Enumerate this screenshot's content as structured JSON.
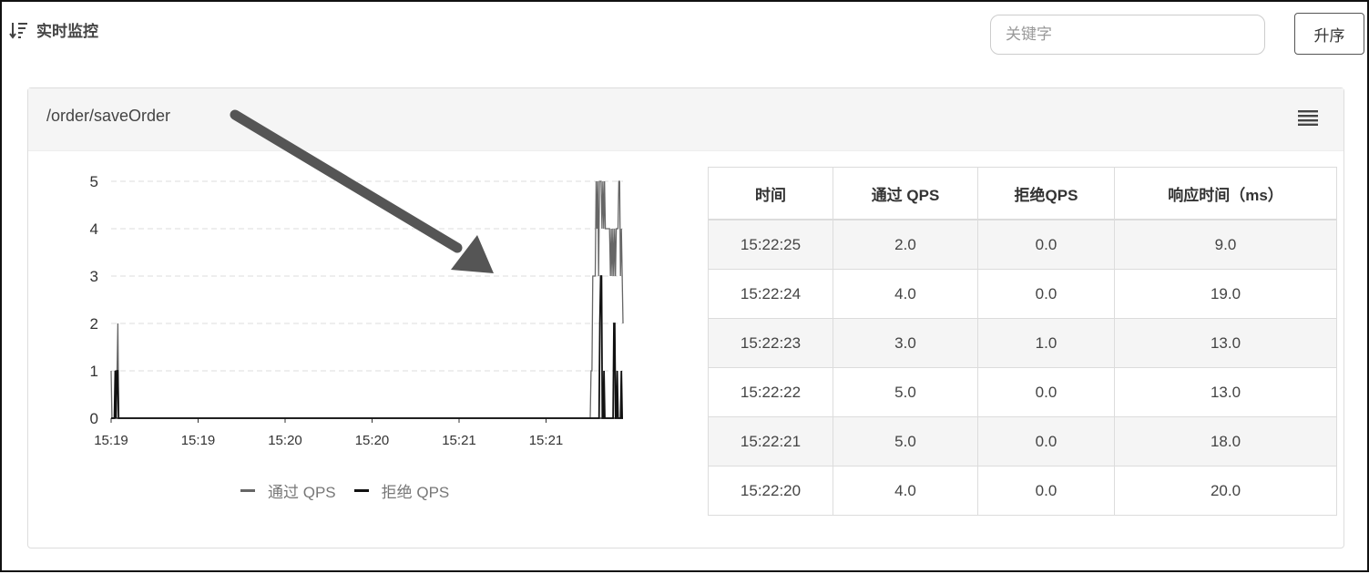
{
  "header": {
    "title": "实时监控",
    "search_placeholder": "关键字",
    "search_value": "",
    "sort_label": "升序"
  },
  "panel": {
    "resource": "/order/saveOrder",
    "menu_icon": "hamburger-menu-icon"
  },
  "chart_data": {
    "type": "line",
    "ylim": [
      0,
      5
    ],
    "yticks": [
      0,
      1,
      2,
      3,
      4,
      5
    ],
    "xtick_labels": [
      "15:19",
      "15:19",
      "15:20",
      "15:20",
      "15:21",
      "15:21"
    ],
    "grid": true,
    "legend_position": "bottom",
    "series": [
      {
        "name": "通过 QPS",
        "color": "#666666",
        "values": [
          1,
          0,
          0,
          0,
          0,
          1,
          1,
          1,
          2,
          0,
          0,
          0,
          0,
          0,
          0,
          0,
          0,
          0,
          0,
          0,
          0,
          0,
          0,
          0,
          0,
          0,
          0,
          0,
          0,
          0,
          0,
          0,
          0,
          0,
          0,
          0,
          0,
          0,
          0,
          0,
          0,
          0,
          0,
          0,
          0,
          0,
          0,
          0,
          0,
          0,
          0,
          0,
          0,
          0,
          0,
          0,
          0,
          0,
          0,
          0,
          0,
          0,
          0,
          0,
          0,
          0,
          0,
          0,
          0,
          0,
          0,
          0,
          0,
          0,
          0,
          0,
          0,
          0,
          0,
          0,
          0,
          0,
          0,
          0,
          0,
          0,
          0,
          0,
          0,
          0,
          0,
          0,
          0,
          0,
          0,
          0,
          0,
          0,
          0,
          0,
          0,
          0,
          0,
          0,
          0,
          0,
          0,
          0,
          0,
          0,
          0,
          0,
          0,
          0,
          0,
          0,
          0,
          0,
          0,
          0,
          0,
          0,
          0,
          0,
          0,
          0,
          0,
          0,
          0,
          0,
          0,
          0,
          0,
          0,
          0,
          0,
          0,
          0,
          0,
          0,
          0,
          0,
          0,
          0,
          0,
          0,
          0,
          0,
          0,
          0,
          0,
          0,
          0,
          0,
          0,
          0,
          0,
          0,
          0,
          0,
          0,
          0,
          0,
          0,
          0,
          0,
          0,
          0,
          0,
          0,
          0,
          0,
          0,
          0,
          0,
          0,
          0,
          0,
          0,
          0,
          0,
          0,
          0,
          0,
          0,
          0,
          0,
          0,
          0,
          0,
          0,
          0,
          0,
          0,
          0,
          0,
          0,
          0,
          0,
          0,
          0,
          0,
          0,
          0,
          0,
          0,
          0,
          0,
          0,
          0,
          0,
          0,
          0,
          0,
          0,
          0,
          0,
          0,
          0,
          0,
          0,
          0,
          0,
          0,
          0,
          0,
          0,
          0,
          0,
          0,
          0,
          0,
          0,
          0,
          0,
          0,
          0,
          0,
          0,
          0,
          0,
          0,
          0,
          0,
          0,
          0,
          0,
          0,
          0,
          0,
          0,
          0,
          0,
          0,
          0,
          0,
          0,
          0,
          0,
          0,
          0,
          0,
          0,
          0,
          0,
          0,
          0,
          0,
          0,
          0,
          0,
          0,
          0,
          0,
          0,
          0,
          0,
          0,
          0,
          0,
          0,
          0,
          0,
          0,
          0,
          0,
          0,
          0,
          0,
          0,
          0,
          0,
          0,
          0,
          0,
          0,
          0,
          0,
          0,
          0,
          0,
          0,
          0,
          0,
          0,
          0,
          0,
          0,
          0,
          0,
          0,
          0,
          0,
          0,
          0,
          0,
          0,
          0,
          0,
          0,
          0,
          0,
          0,
          0,
          0,
          0,
          0,
          0,
          0,
          0,
          0,
          0,
          0,
          0,
          0,
          0,
          0,
          0,
          0,
          0,
          0,
          0,
          0,
          0,
          0,
          0,
          0,
          0,
          0,
          0,
          0,
          0,
          0,
          0,
          0,
          0,
          0,
          0,
          0,
          0,
          0,
          0,
          0,
          0,
          0,
          0,
          0,
          0,
          0,
          0,
          0,
          0,
          0,
          0,
          0,
          0,
          0,
          0,
          0,
          0,
          0,
          0,
          0,
          0,
          0,
          0,
          0,
          0,
          0,
          0,
          0,
          0,
          0,
          0,
          0,
          0,
          0,
          0,
          0,
          0,
          0,
          0,
          0,
          0,
          0,
          0,
          0,
          0,
          0,
          0,
          0,
          0,
          0,
          0,
          0,
          0,
          0,
          0,
          0,
          0,
          0,
          0,
          0,
          0,
          0,
          0,
          0,
          0,
          0,
          0,
          0,
          0,
          0,
          0,
          0,
          0,
          0,
          0,
          0,
          0,
          0,
          0,
          0,
          0,
          0,
          0,
          0,
          0,
          0,
          0,
          0,
          0,
          0,
          0,
          0,
          0,
          0,
          0,
          0,
          0,
          0,
          0,
          0,
          0,
          0,
          0,
          0,
          0,
          0,
          0,
          0,
          0,
          0,
          0,
          0,
          0,
          0,
          0,
          0,
          0,
          0,
          0,
          0,
          0,
          0,
          0,
          0,
          0,
          0,
          0,
          0,
          0,
          0,
          0,
          0,
          0,
          0,
          0,
          0,
          0,
          0,
          0,
          0,
          0,
          0,
          0,
          0,
          0,
          0,
          0,
          0,
          0,
          0,
          0,
          0,
          0,
          0,
          0,
          0,
          0,
          0,
          0,
          0,
          0,
          0,
          0,
          0,
          0,
          0,
          0,
          0,
          0,
          0,
          0,
          0,
          0,
          0,
          0,
          0,
          0,
          0,
          0,
          0,
          0,
          0,
          0,
          0,
          0,
          0,
          0,
          0,
          0,
          0,
          0,
          0,
          0,
          0,
          0,
          0,
          0,
          0,
          0,
          0,
          0,
          0,
          0,
          0,
          0,
          0,
          0,
          0,
          1,
          1,
          3,
          3,
          3,
          3,
          5,
          4,
          5,
          3,
          5,
          5,
          5,
          4,
          5,
          4,
          5,
          4,
          4,
          4,
          4,
          4,
          4,
          3,
          4,
          3,
          4,
          3,
          4,
          3,
          4,
          4,
          4,
          5,
          5,
          3,
          4,
          3,
          2
        ]
      },
      {
        "name": "拒绝 QPS",
        "color": "#111111",
        "values": [
          0,
          0,
          0,
          0,
          0,
          1,
          0,
          1,
          1,
          0,
          0,
          0,
          0,
          0,
          0,
          0,
          0,
          0,
          0,
          0,
          0,
          0,
          0,
          0,
          0,
          0,
          0,
          0,
          0,
          0,
          0,
          0,
          0,
          0,
          0,
          0,
          0,
          0,
          0,
          0,
          0,
          0,
          0,
          0,
          0,
          0,
          0,
          0,
          0,
          0,
          0,
          0,
          0,
          0,
          0,
          0,
          0,
          0,
          0,
          0,
          0,
          0,
          0,
          0,
          0,
          0,
          0,
          0,
          0,
          0,
          0,
          0,
          0,
          0,
          0,
          0,
          0,
          0,
          0,
          0,
          0,
          0,
          0,
          0,
          0,
          0,
          0,
          0,
          0,
          0,
          0,
          0,
          0,
          0,
          0,
          0,
          0,
          0,
          0,
          0,
          0,
          0,
          0,
          0,
          0,
          0,
          0,
          0,
          0,
          0,
          0,
          0,
          0,
          0,
          0,
          0,
          0,
          0,
          0,
          0,
          0,
          0,
          0,
          0,
          0,
          0,
          0,
          0,
          0,
          0,
          0,
          0,
          0,
          0,
          0,
          0,
          0,
          0,
          0,
          0,
          0,
          0,
          0,
          0,
          0,
          0,
          0,
          0,
          0,
          0,
          0,
          0,
          0,
          0,
          0,
          0,
          0,
          0,
          0,
          0,
          0,
          0,
          0,
          0,
          0,
          0,
          0,
          0,
          0,
          0,
          0,
          0,
          0,
          0,
          0,
          0,
          0,
          0,
          0,
          0,
          0,
          0,
          0,
          0,
          0,
          0,
          0,
          0,
          0,
          0,
          0,
          0,
          0,
          0,
          0,
          0,
          0,
          0,
          0,
          0,
          0,
          0,
          0,
          0,
          0,
          0,
          0,
          0,
          0,
          0,
          0,
          0,
          0,
          0,
          0,
          0,
          0,
          0,
          0,
          0,
          0,
          0,
          0,
          0,
          0,
          0,
          0,
          0,
          0,
          0,
          0,
          0,
          0,
          0,
          0,
          0,
          0,
          0,
          0,
          0,
          0,
          0,
          0,
          0,
          0,
          0,
          0,
          0,
          0,
          0,
          0,
          0,
          0,
          0,
          0,
          0,
          0,
          0,
          0,
          0,
          0,
          0,
          0,
          0,
          0,
          0,
          0,
          0,
          0,
          0,
          0,
          0,
          0,
          0,
          0,
          0,
          0,
          0,
          0,
          0,
          0,
          0,
          0,
          0,
          0,
          0,
          0,
          0,
          0,
          0,
          0,
          0,
          0,
          0,
          0,
          0,
          0,
          0,
          0,
          0,
          0,
          0,
          0,
          0,
          0,
          0,
          0,
          0,
          0,
          0,
          0,
          0,
          0,
          0,
          0,
          0,
          0,
          0,
          0,
          0,
          0,
          0,
          0,
          0,
          0,
          0,
          0,
          0,
          0,
          0,
          0,
          0,
          0,
          0,
          0,
          0,
          0,
          0,
          0,
          0,
          0,
          0,
          0,
          0,
          0,
          0,
          0,
          0,
          0,
          0,
          0,
          0,
          0,
          0,
          0,
          0,
          0,
          0,
          0,
          0,
          0,
          0,
          0,
          0,
          0,
          0,
          0,
          0,
          0,
          0,
          0,
          0,
          0,
          0,
          0,
          0,
          0,
          0,
          0,
          0,
          0,
          0,
          0,
          0,
          0,
          0,
          0,
          0,
          0,
          0,
          0,
          0,
          0,
          0,
          0,
          0,
          0,
          0,
          0,
          0,
          0,
          0,
          0,
          0,
          0,
          0,
          0,
          0,
          0,
          0,
          0,
          0,
          0,
          0,
          0,
          0,
          0,
          0,
          0,
          0,
          0,
          0,
          0,
          0,
          0,
          0,
          0,
          0,
          0,
          0,
          0,
          0,
          0,
          0,
          0,
          0,
          0,
          0,
          0,
          0,
          0,
          0,
          0,
          0,
          0,
          0,
          0,
          0,
          0,
          0,
          0,
          0,
          0,
          0,
          0,
          0,
          0,
          0,
          0,
          0,
          0,
          0,
          0,
          0,
          0,
          0,
          0,
          0,
          0,
          0,
          0,
          0,
          0,
          0,
          0,
          0,
          0,
          0,
          0,
          0,
          0,
          0,
          0,
          0,
          0,
          0,
          0,
          0,
          0,
          0,
          0,
          0,
          0,
          0,
          0,
          0,
          0,
          0,
          0,
          0,
          0,
          0,
          0,
          0,
          0,
          0,
          0,
          0,
          0,
          0,
          0,
          0,
          0,
          0,
          0,
          0,
          0,
          0,
          0,
          0,
          0,
          0,
          0,
          0,
          0,
          0,
          0,
          0,
          0,
          0,
          0,
          0,
          0,
          0,
          0,
          0,
          0,
          0,
          0,
          0,
          0,
          0,
          0,
          0,
          0,
          0,
          0,
          0,
          0,
          0,
          0,
          0,
          0,
          0,
          0,
          0,
          0,
          0,
          0,
          0,
          0,
          0,
          0,
          0,
          0,
          0,
          0,
          0,
          0,
          0,
          0,
          0,
          0,
          0,
          0,
          0,
          0,
          0,
          0,
          0,
          0,
          0,
          0,
          0,
          0,
          0,
          0,
          0,
          0,
          0,
          0,
          2,
          3,
          3,
          0,
          0,
          1,
          0,
          0,
          0,
          0,
          0,
          0,
          0,
          0,
          0,
          0,
          0,
          2,
          2,
          0,
          0,
          1,
          0,
          0,
          0,
          0,
          1,
          0,
          0
        ]
      }
    ]
  },
  "table": {
    "headers": [
      "时间",
      "通过 QPS",
      "拒绝QPS",
      "响应时间（ms）"
    ],
    "rows": [
      [
        "15:22:25",
        "2.0",
        "0.0",
        "9.0"
      ],
      [
        "15:22:24",
        "4.0",
        "0.0",
        "19.0"
      ],
      [
        "15:22:23",
        "3.0",
        "1.0",
        "13.0"
      ],
      [
        "15:22:22",
        "5.0",
        "0.0",
        "13.0"
      ],
      [
        "15:22:21",
        "5.0",
        "0.0",
        "18.0"
      ],
      [
        "15:22:20",
        "4.0",
        "0.0",
        "20.0"
      ]
    ]
  }
}
